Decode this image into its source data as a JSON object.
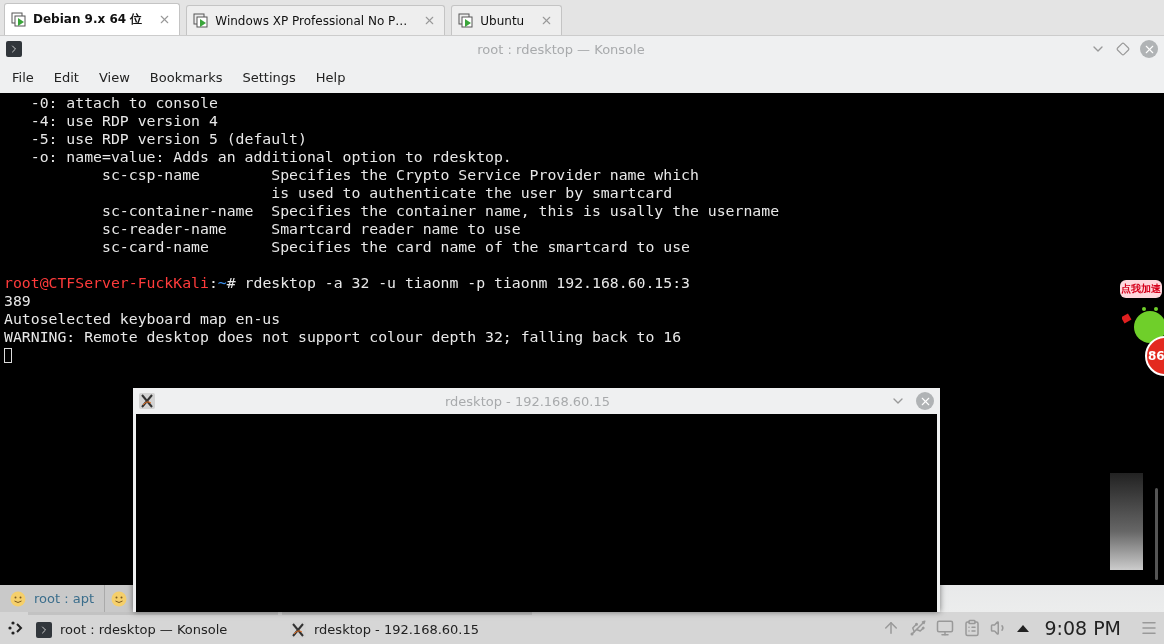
{
  "vm_tabs": [
    {
      "label": "Debian 9.x 64 位",
      "selected": true
    },
    {
      "label": "Windows XP Professional No P…",
      "selected": false
    },
    {
      "label": "Ubuntu",
      "selected": false
    }
  ],
  "konsole": {
    "title": "root : rdesktop — Konsole",
    "menu": [
      "File",
      "Edit",
      "View",
      "Bookmarks",
      "Settings",
      "Help"
    ],
    "terminal": [
      {
        "kind": "output",
        "text": "   -0: attach to console"
      },
      {
        "kind": "output",
        "text": "   -4: use RDP version 4"
      },
      {
        "kind": "output",
        "text": "   -5: use RDP version 5 (default)"
      },
      {
        "kind": "output",
        "text": "   -o: name=value: Adds an additional option to rdesktop."
      },
      {
        "kind": "output",
        "text": "           sc-csp-name        Specifies the Crypto Service Provider name which"
      },
      {
        "kind": "output",
        "text": "                              is used to authenticate the user by smartcard"
      },
      {
        "kind": "output",
        "text": "           sc-container-name  Specifies the container name, this is usally the username"
      },
      {
        "kind": "output",
        "text": "           sc-reader-name     Smartcard reader name to use"
      },
      {
        "kind": "output",
        "text": "           sc-card-name       Specifies the card name of the smartcard to use"
      },
      {
        "kind": "blank"
      },
      {
        "kind": "prompt",
        "user": "root@CTFServer-FuckKali",
        "sep": ":",
        "path": "~",
        "command": "# rdesktop -a 32 -u tiaonm -p tiaonm 192.168.60.15:3"
      },
      {
        "kind": "output",
        "text": "389"
      },
      {
        "kind": "output",
        "text": "Autoselected keyboard map en-us"
      },
      {
        "kind": "output",
        "text": "WARNING: Remote desktop does not support colour depth 32; falling back to 16"
      },
      {
        "kind": "cursor"
      }
    ],
    "tabs": [
      {
        "kind": "labeled",
        "label": "root : apt"
      },
      {
        "kind": "covered"
      }
    ]
  },
  "rdesktop_window": {
    "title": "rdesktop - 192.168.60.15"
  },
  "overlay": {
    "bubble": "点我加速",
    "badge": "86"
  },
  "taskbar": {
    "tasks": [
      {
        "kind": "konsole",
        "label": "root : rdesktop — Konsole"
      },
      {
        "kind": "x11",
        "label": "rdesktop - 192.168.60.15"
      }
    ],
    "clock": "9:08 PM"
  }
}
